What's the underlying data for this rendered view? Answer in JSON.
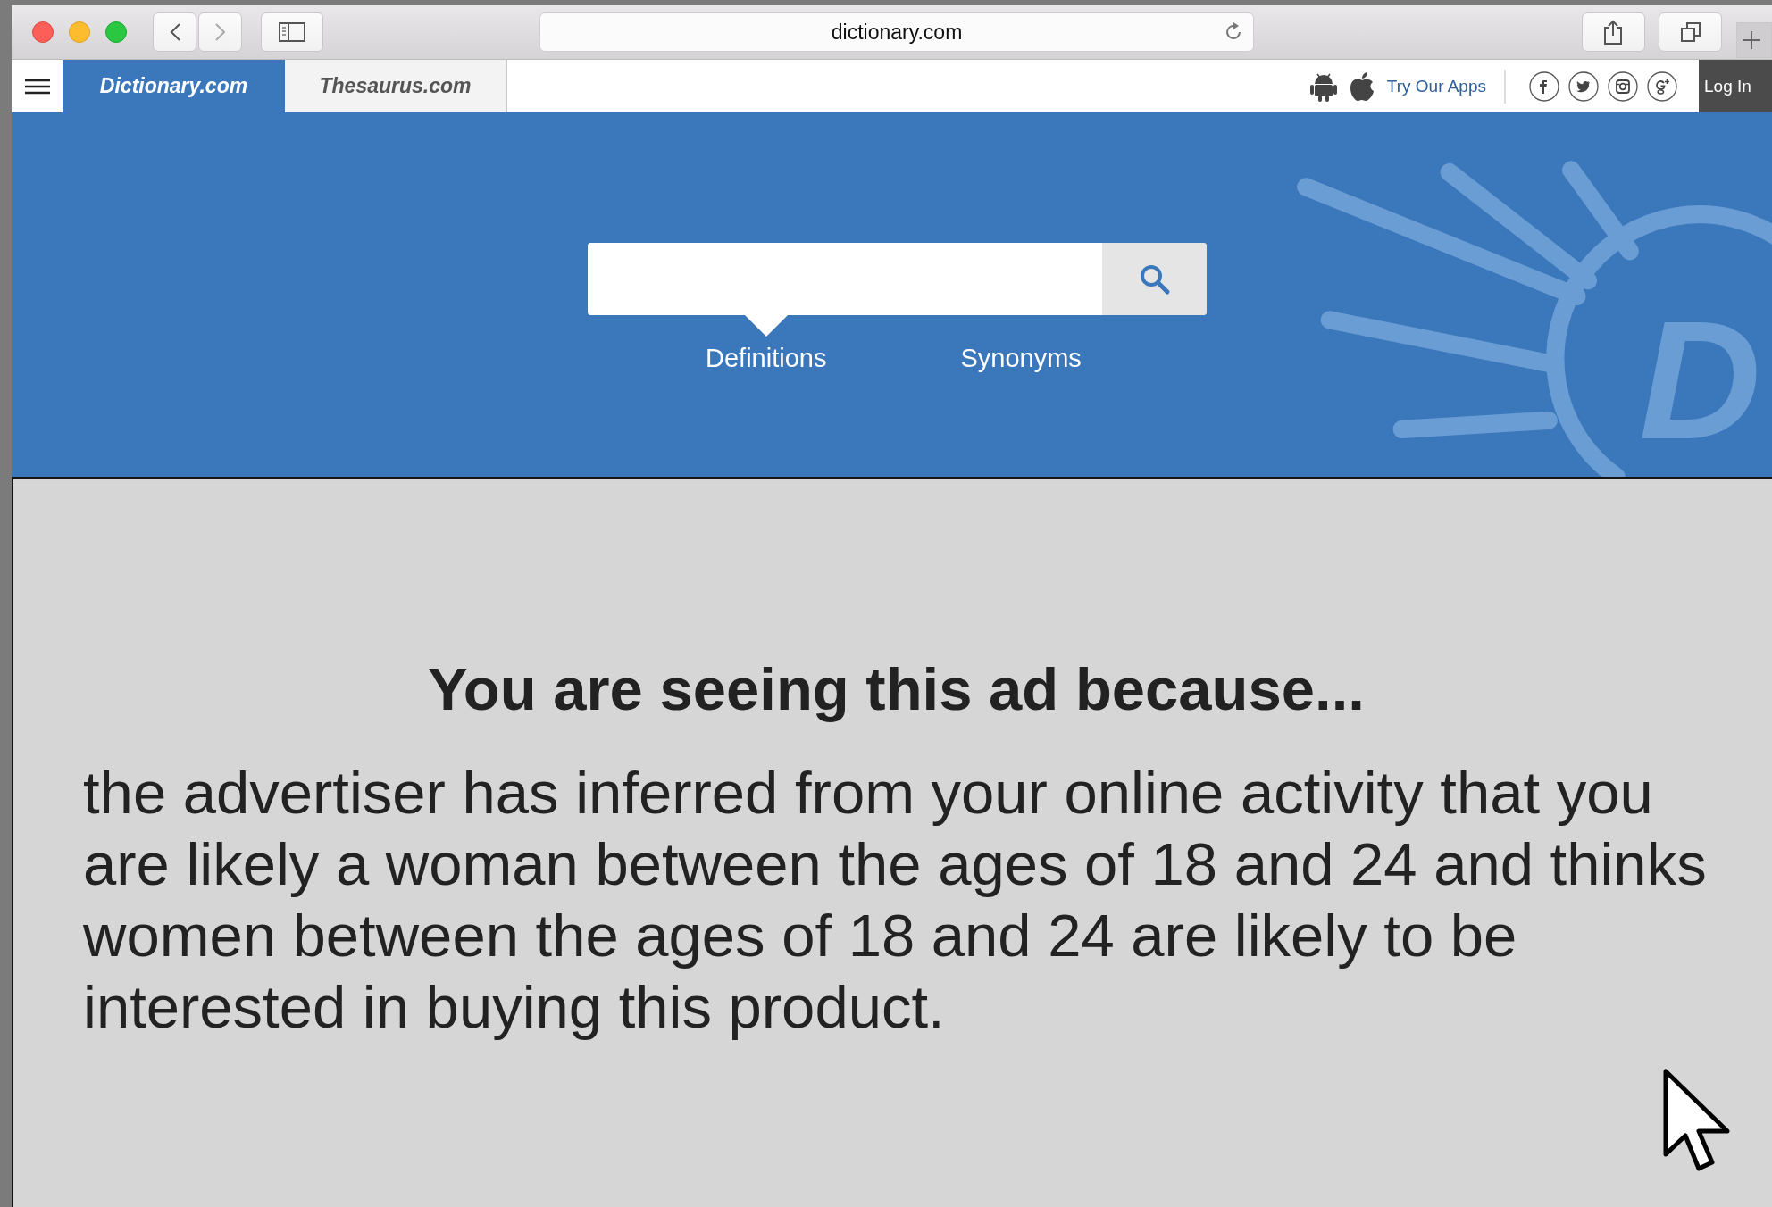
{
  "browser": {
    "url": "dictionary.com"
  },
  "nav": {
    "tabs": [
      {
        "label": "Dictionary.com",
        "selected": true
      },
      {
        "label": "Thesaurus.com",
        "selected": false
      }
    ],
    "apps_link": "Try Our Apps",
    "login": "Log In"
  },
  "hero": {
    "modes": [
      {
        "label": "Definitions",
        "selected": true
      },
      {
        "label": "Synonyms",
        "selected": false
      }
    ],
    "logo_letter": "D"
  },
  "ad": {
    "heading": "You are seeing this ad because...",
    "body": "the advertiser has inferred from your online activity that you are likely a woman between the ages of 18 and 24 and thinks women between the ages of 18 and 24 are likely to be interested in buying this product."
  }
}
